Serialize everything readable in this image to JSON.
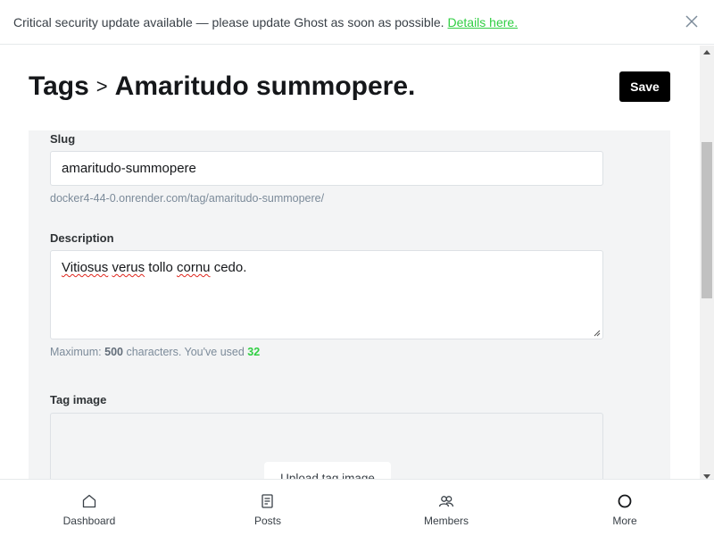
{
  "banner": {
    "message": "Critical security update available — please update Ghost as soon as possible.",
    "link_text": "Details here."
  },
  "header": {
    "breadcrumb_parent": "Tags",
    "separator": ">",
    "title": "Amaritudo summopere."
  },
  "toolbar": {
    "save_label": "Save"
  },
  "form": {
    "slug_label": "Slug",
    "slug_value": "amaritudo-summopere",
    "slug_url": "docker4-44-0.onrender.com/tag/amaritudo-summopere/",
    "description_label": "Description",
    "description_words": [
      "Vitiosus",
      "verus",
      "tollo",
      "cornu",
      "cedo."
    ],
    "hint_prefix": "Maximum: ",
    "hint_max": "500",
    "hint_middle": " characters. You've used ",
    "hint_used": "32",
    "image_label": "Tag image",
    "upload_label": "Upload tag image"
  },
  "bottom_nav": [
    {
      "label": "Dashboard",
      "icon": "home-icon"
    },
    {
      "label": "Posts",
      "icon": "posts-icon"
    },
    {
      "label": "Members",
      "icon": "members-icon"
    },
    {
      "label": "More",
      "icon": "more-icon"
    }
  ],
  "colors": {
    "accent": "#30cf43",
    "button": "#000000"
  }
}
